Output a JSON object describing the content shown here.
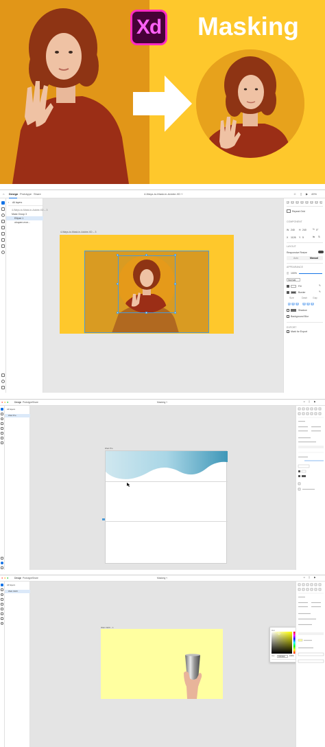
{
  "hero": {
    "logo_text": "Xd",
    "title": "Masking",
    "colors": {
      "left_bg": "#e59a1a",
      "right_bg": "#fec82c",
      "logo_bg": "#470137",
      "logo_border": "#ff2bc2"
    }
  },
  "panel2": {
    "tabs": [
      "Design",
      "Prototype",
      "Share"
    ],
    "doc_title": "4-Ways-to-Mask-in-Adobe-XD ˅",
    "zoom": "49%",
    "layers": {
      "header": "All layers",
      "items": [
        "4-Ways-to-Mask-in-Adobe-XD – 3",
        "Mask Group 3",
        "Ellipse 1",
        "ukuyam-mon..."
      ]
    },
    "artboard_label": "4-Ways-to-Mask-in-Adobe-XD – 3",
    "inspector": {
      "repeat_grid": "Repeat Grid",
      "component": "COMPONENT",
      "w_label": "W",
      "w_value": "240",
      "h_label": "H",
      "h_value": "240",
      "x_label": "X",
      "x_value": "1126",
      "y_label": "Y",
      "y_value": "5",
      "rotation": "0°",
      "layout": "LAYOUT",
      "responsive_resize": "Responsive Resize",
      "auto": "Auto",
      "manual": "Manual",
      "appearance": "APPEARANCE",
      "opacity": "100%",
      "blend": "Normal",
      "fill": "Fill",
      "border": "Border",
      "size_label": "Size",
      "dash_label": "Dash",
      "gap_label": "Gap",
      "shadow": "Shadow",
      "bg_blur": "Background Blur",
      "shadow_values": "X 0  Y 0  B 0",
      "export": "EXPORT",
      "mark_export": "Mark for Export"
    }
  },
  "panel3": {
    "tabs": [
      "Design",
      "Prototype",
      "Share"
    ],
    "doc_title": "Masking ˅",
    "artboard_label": "iPad Pro",
    "layers": {
      "header": "All layers",
      "items": [
        "iPad Pro"
      ]
    }
  },
  "panel4": {
    "tabs": [
      "Design",
      "Prototype",
      "Share"
    ],
    "doc_title": "Masking ˅",
    "artboard_label": "Web 1920 – 1",
    "layers": {
      "header": "All layers",
      "items": [
        "Web 1920"
      ]
    },
    "picker": {
      "mode": "Hex",
      "hex_value": "FFFFA0",
      "opacity": "100%"
    },
    "colors": {
      "artboard_bg": "#ffffa0"
    }
  }
}
